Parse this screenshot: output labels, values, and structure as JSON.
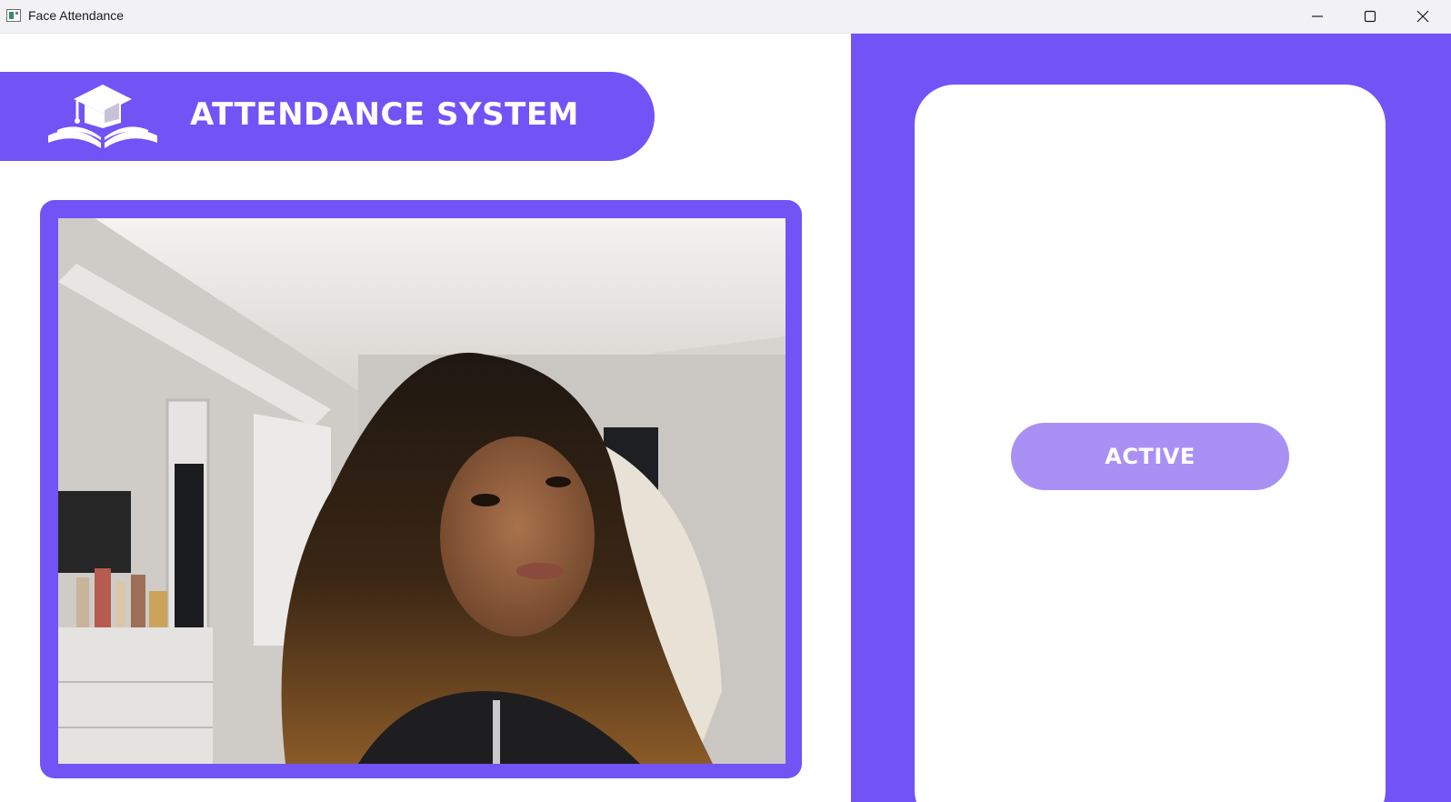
{
  "window": {
    "title": "Face Attendance",
    "icon": "app-window-icon",
    "controls": [
      "minimize-icon",
      "maximize-icon",
      "close-icon"
    ]
  },
  "header": {
    "title": "ATTENDANCE SYSTEM",
    "logo_icon": "graduation-cap-book-icon"
  },
  "camera": {
    "feed_description_icon": "webcam-feed"
  },
  "status": {
    "label": "ACTIVE"
  },
  "colors": {
    "accent": "#7153f6",
    "status_pill": "#a990f5",
    "card": "#ffffff"
  }
}
